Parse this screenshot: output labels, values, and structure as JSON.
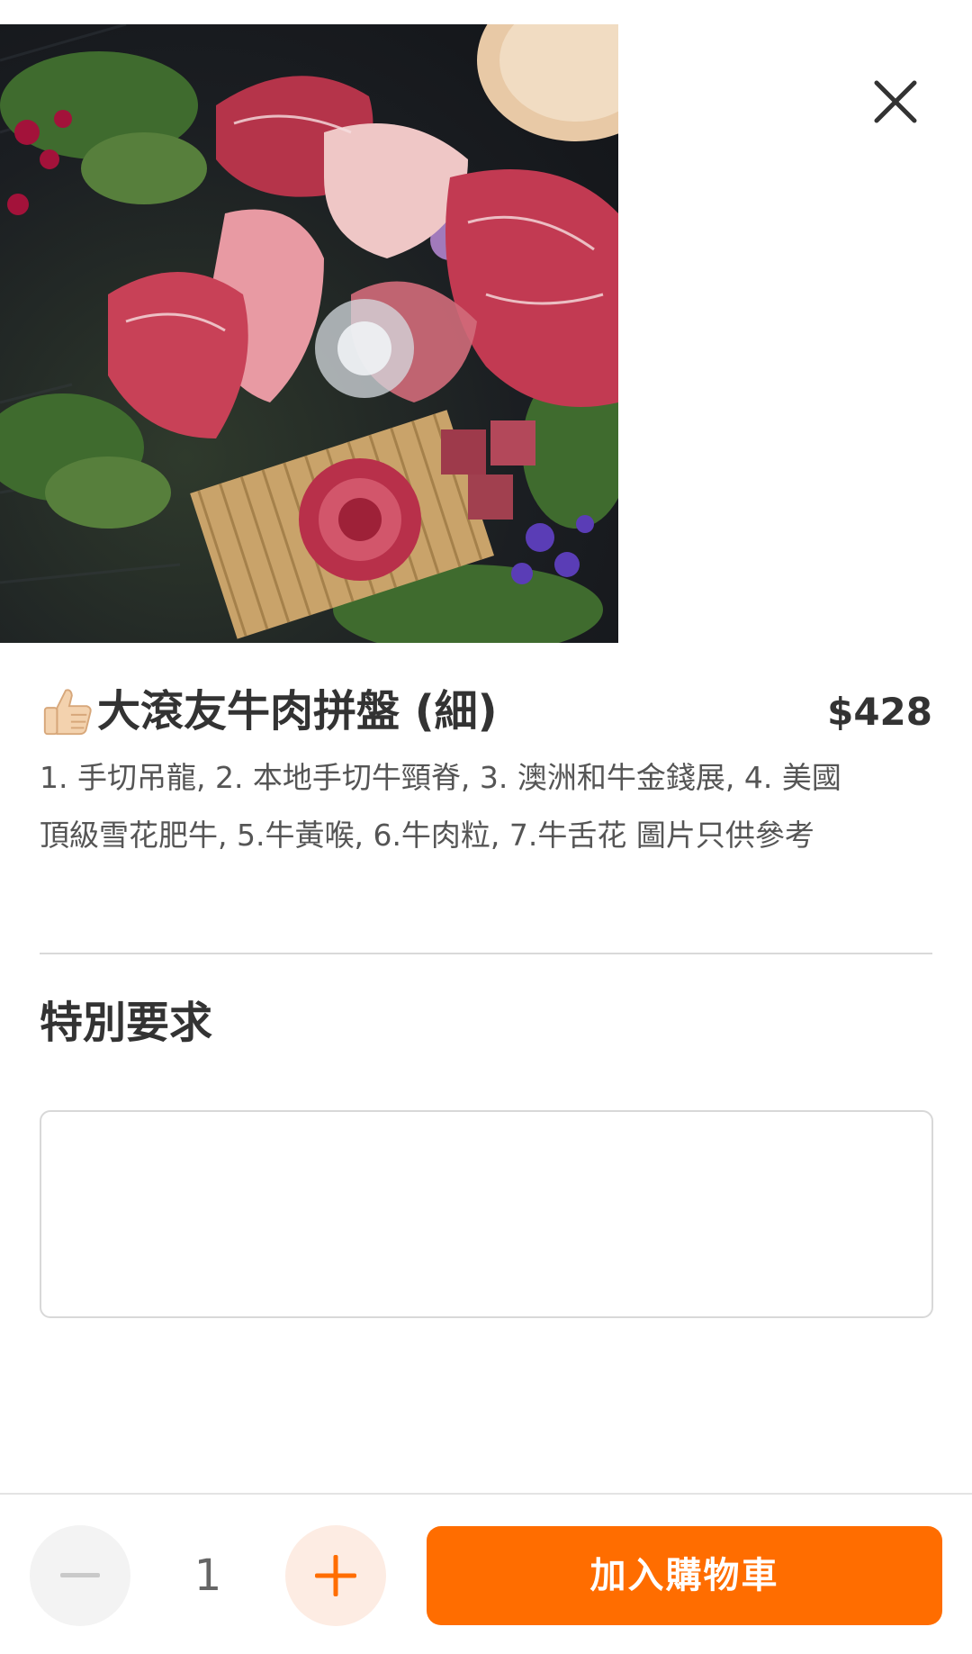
{
  "product": {
    "title_emoji": "👍🏻",
    "title": "大滾友牛肉拼盤 (細)",
    "price": "$428",
    "description": "1. 手切吊龍, 2. 本地手切牛頸脊, 3. 澳洲和牛金錢展, 4. 美國頂級雪花肥牛, 5.牛黃喉, 6.牛肉粒, 7.牛舌花 圖片只供參考"
  },
  "special_request": {
    "title": "特別要求",
    "value": "",
    "placeholder": ""
  },
  "cart": {
    "quantity": "1",
    "add_label": "加入購物車"
  },
  "icons": {
    "close": "close-icon",
    "minus": "minus-icon",
    "plus": "plus-icon",
    "thumb": "thumbs-up-icon"
  },
  "colors": {
    "accent": "#ff6d00",
    "accent_light": "#fdece3",
    "text": "#333333",
    "muted": "#555555"
  }
}
